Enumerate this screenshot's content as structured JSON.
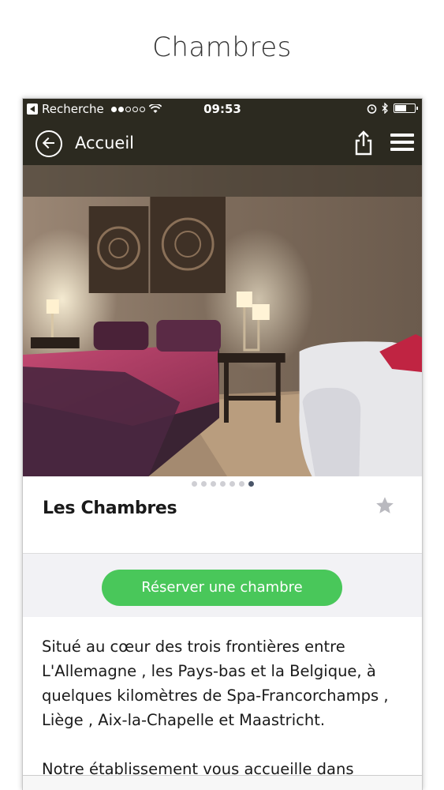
{
  "page": {
    "title": "Chambres"
  },
  "statusbar": {
    "back_app": "Recherche",
    "time": "09:53"
  },
  "navbar": {
    "back_label": "Accueil"
  },
  "gallery": {
    "image": "hotel-room-photo",
    "page_count": 7,
    "active_index": 6
  },
  "room": {
    "title": "Les Chambres"
  },
  "booking": {
    "button_label": "Réserver une chambre"
  },
  "description": {
    "paragraph1": "Situé au cœur des trois frontières entre L'Allemagne , les Pays-bas et la Belgique, à quelques kilomètres de Spa-Francorchamps , Liège , Aix-la-Chapelle et Maastricht.",
    "paragraph2": "Notre établissement vous accueille dans"
  },
  "colors": {
    "navbar_bg": "#2c2a20",
    "accent_green": "#49c75a",
    "active_dot": "#4a5568"
  }
}
